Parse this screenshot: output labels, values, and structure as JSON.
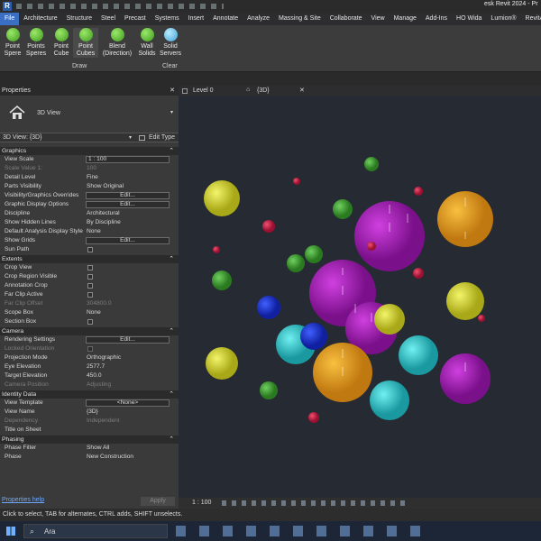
{
  "title": {
    "app_suffix": "esk Revit 2024 - Pr"
  },
  "ribbon": {
    "file_label": "File",
    "tabs": [
      "Architecture",
      "Structure",
      "Steel",
      "Precast",
      "Systems",
      "Insert",
      "Annotate",
      "Analyze",
      "Massing & Site",
      "Collaborate",
      "View",
      "Manage",
      "Add-Ins",
      "HO Wida",
      "Lumion®",
      "RevitA"
    ],
    "buttons": [
      {
        "label1": "Point",
        "label2": "Spere"
      },
      {
        "label1": "Points",
        "label2": "Speres"
      },
      {
        "label1": "Point",
        "label2": "Cube"
      },
      {
        "label1": "Point",
        "label2": "Cubes"
      },
      {
        "label1": "Blend",
        "label2": "(Direction)"
      },
      {
        "label1": "Wall",
        "label2": "Solids"
      },
      {
        "label1": "Solid",
        "label2": "Servers"
      }
    ],
    "panel_draw": "Draw",
    "panel_clear": "Clear"
  },
  "properties": {
    "header": "Properties",
    "type_name": "3D View",
    "selector": "3D View: {3D}",
    "edit_type": "Edit Type",
    "sections": {
      "graphics": "Graphics",
      "extents": "Extents",
      "camera": "Camera",
      "identity": "Identity Data",
      "phasing": "Phasing"
    },
    "rows": {
      "view_scale": {
        "k": "View Scale",
        "v": "1 : 100"
      },
      "scale_value": {
        "k": "Scale Value    1:",
        "v": "100"
      },
      "detail_level": {
        "k": "Detail Level",
        "v": "Fine"
      },
      "parts_visibility": {
        "k": "Parts Visibility",
        "v": "Show Original"
      },
      "vg_overrides": {
        "k": "Visibility/Graphics Overrides",
        "v": "Edit..."
      },
      "graphic_display": {
        "k": "Graphic Display Options",
        "v": "Edit..."
      },
      "discipline": {
        "k": "Discipline",
        "v": "Architectural"
      },
      "show_hidden": {
        "k": "Show Hidden Lines",
        "v": "By Discipline"
      },
      "default_analysis": {
        "k": "Default Analysis Display Style",
        "v": "None"
      },
      "show_grids": {
        "k": "Show Grids",
        "v": "Edit..."
      },
      "sun_path": {
        "k": "Sun Path"
      },
      "crop_view": {
        "k": "Crop View"
      },
      "crop_region": {
        "k": "Crop Region Visible"
      },
      "annotation_crop": {
        "k": "Annotation Crop"
      },
      "far_clip_active": {
        "k": "Far Clip Active"
      },
      "far_clip_offset": {
        "k": "Far Clip Offset",
        "v": "304800.0"
      },
      "scope_box": {
        "k": "Scope Box",
        "v": "None"
      },
      "section_box": {
        "k": "Section Box"
      },
      "rendering_settings": {
        "k": "Rendering Settings",
        "v": "Edit..."
      },
      "locked_orientation": {
        "k": "Locked Orientation"
      },
      "projection_mode": {
        "k": "Projection Mode",
        "v": "Orthographic"
      },
      "eye_elevation": {
        "k": "Eye Elevation",
        "v": "2577.7"
      },
      "target_elevation": {
        "k": "Target Elevation",
        "v": "450.0"
      },
      "camera_position": {
        "k": "Camera Position",
        "v": "Adjusting"
      },
      "view_template": {
        "k": "View Template",
        "v": "<None>"
      },
      "view_name": {
        "k": "View Name",
        "v": "{3D}"
      },
      "dependency": {
        "k": "Dependency",
        "v": "Independent"
      },
      "title_on_sheet": {
        "k": "Title on Sheet"
      },
      "phase_filter": {
        "k": "Phase Filter",
        "v": "Show All"
      },
      "phase": {
        "k": "Phase",
        "v": "New Construction"
      }
    },
    "help_link": "Properties help",
    "apply": "Apply"
  },
  "view_tabs": {
    "level0": "Level 0",
    "three_d": "{3D}"
  },
  "view_bar": {
    "scale": "1 : 100"
  },
  "status": "Click to select, TAB for alternates, CTRL adds, SHIFT unselects.",
  "taskbar": {
    "search": "Ara"
  },
  "colors": {
    "accent": "#3a6fc4",
    "yellow": "#d8d830",
    "orange": "#e8a020",
    "magenta": "#b820c8",
    "cyan": "#30c8c8",
    "green": "#40b030",
    "red": "#d02040",
    "blue": "#2030d0"
  }
}
